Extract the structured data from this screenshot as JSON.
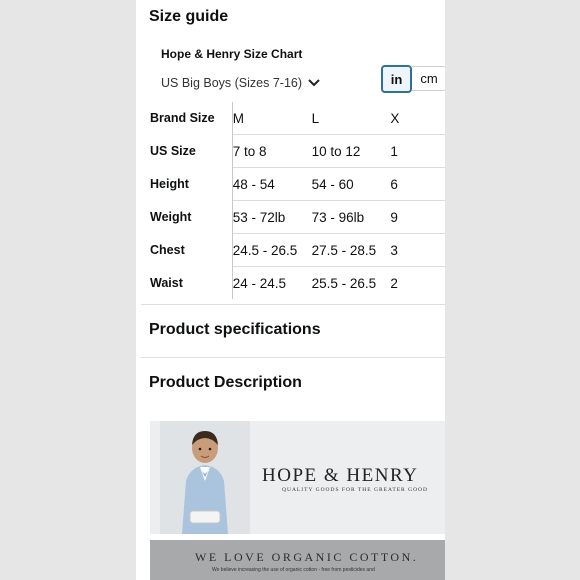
{
  "size_guide": {
    "title": "Size guide",
    "chart_title": "Hope & Henry Size Chart",
    "group_select": "US Big Boys (Sizes 7-16)",
    "units": {
      "in": "in",
      "cm": "cm",
      "selected": "in"
    },
    "table": {
      "rows": [
        {
          "label": "Brand Size",
          "cells": [
            "M",
            "L",
            "X"
          ]
        },
        {
          "label": "US Size",
          "cells": [
            "7 to 8",
            "10 to 12",
            "1"
          ]
        },
        {
          "label": "Height",
          "cells": [
            "48 - 54",
            "54 - 60",
            "6"
          ]
        },
        {
          "label": "Weight",
          "cells": [
            "53 - 72lb",
            "73 - 96lb",
            "9"
          ]
        },
        {
          "label": "Chest",
          "cells": [
            "24.5 - 26.5",
            "27.5 - 28.5",
            "3"
          ]
        },
        {
          "label": "Waist",
          "cells": [
            "24 - 24.5",
            "25.5 - 26.5",
            "2"
          ]
        }
      ]
    }
  },
  "sections": {
    "specifications": "Product specifications",
    "description": "Product Description"
  },
  "banner": {
    "brand": "HOPE & HENRY",
    "tagline": "QUALITY GOODS FOR THE GREATER GOOD"
  },
  "banner2": {
    "headline": "WE LOVE ORGANIC COTTON.",
    "subtext": "We believe increasing the use of organic cotton - free from pesticides and"
  }
}
